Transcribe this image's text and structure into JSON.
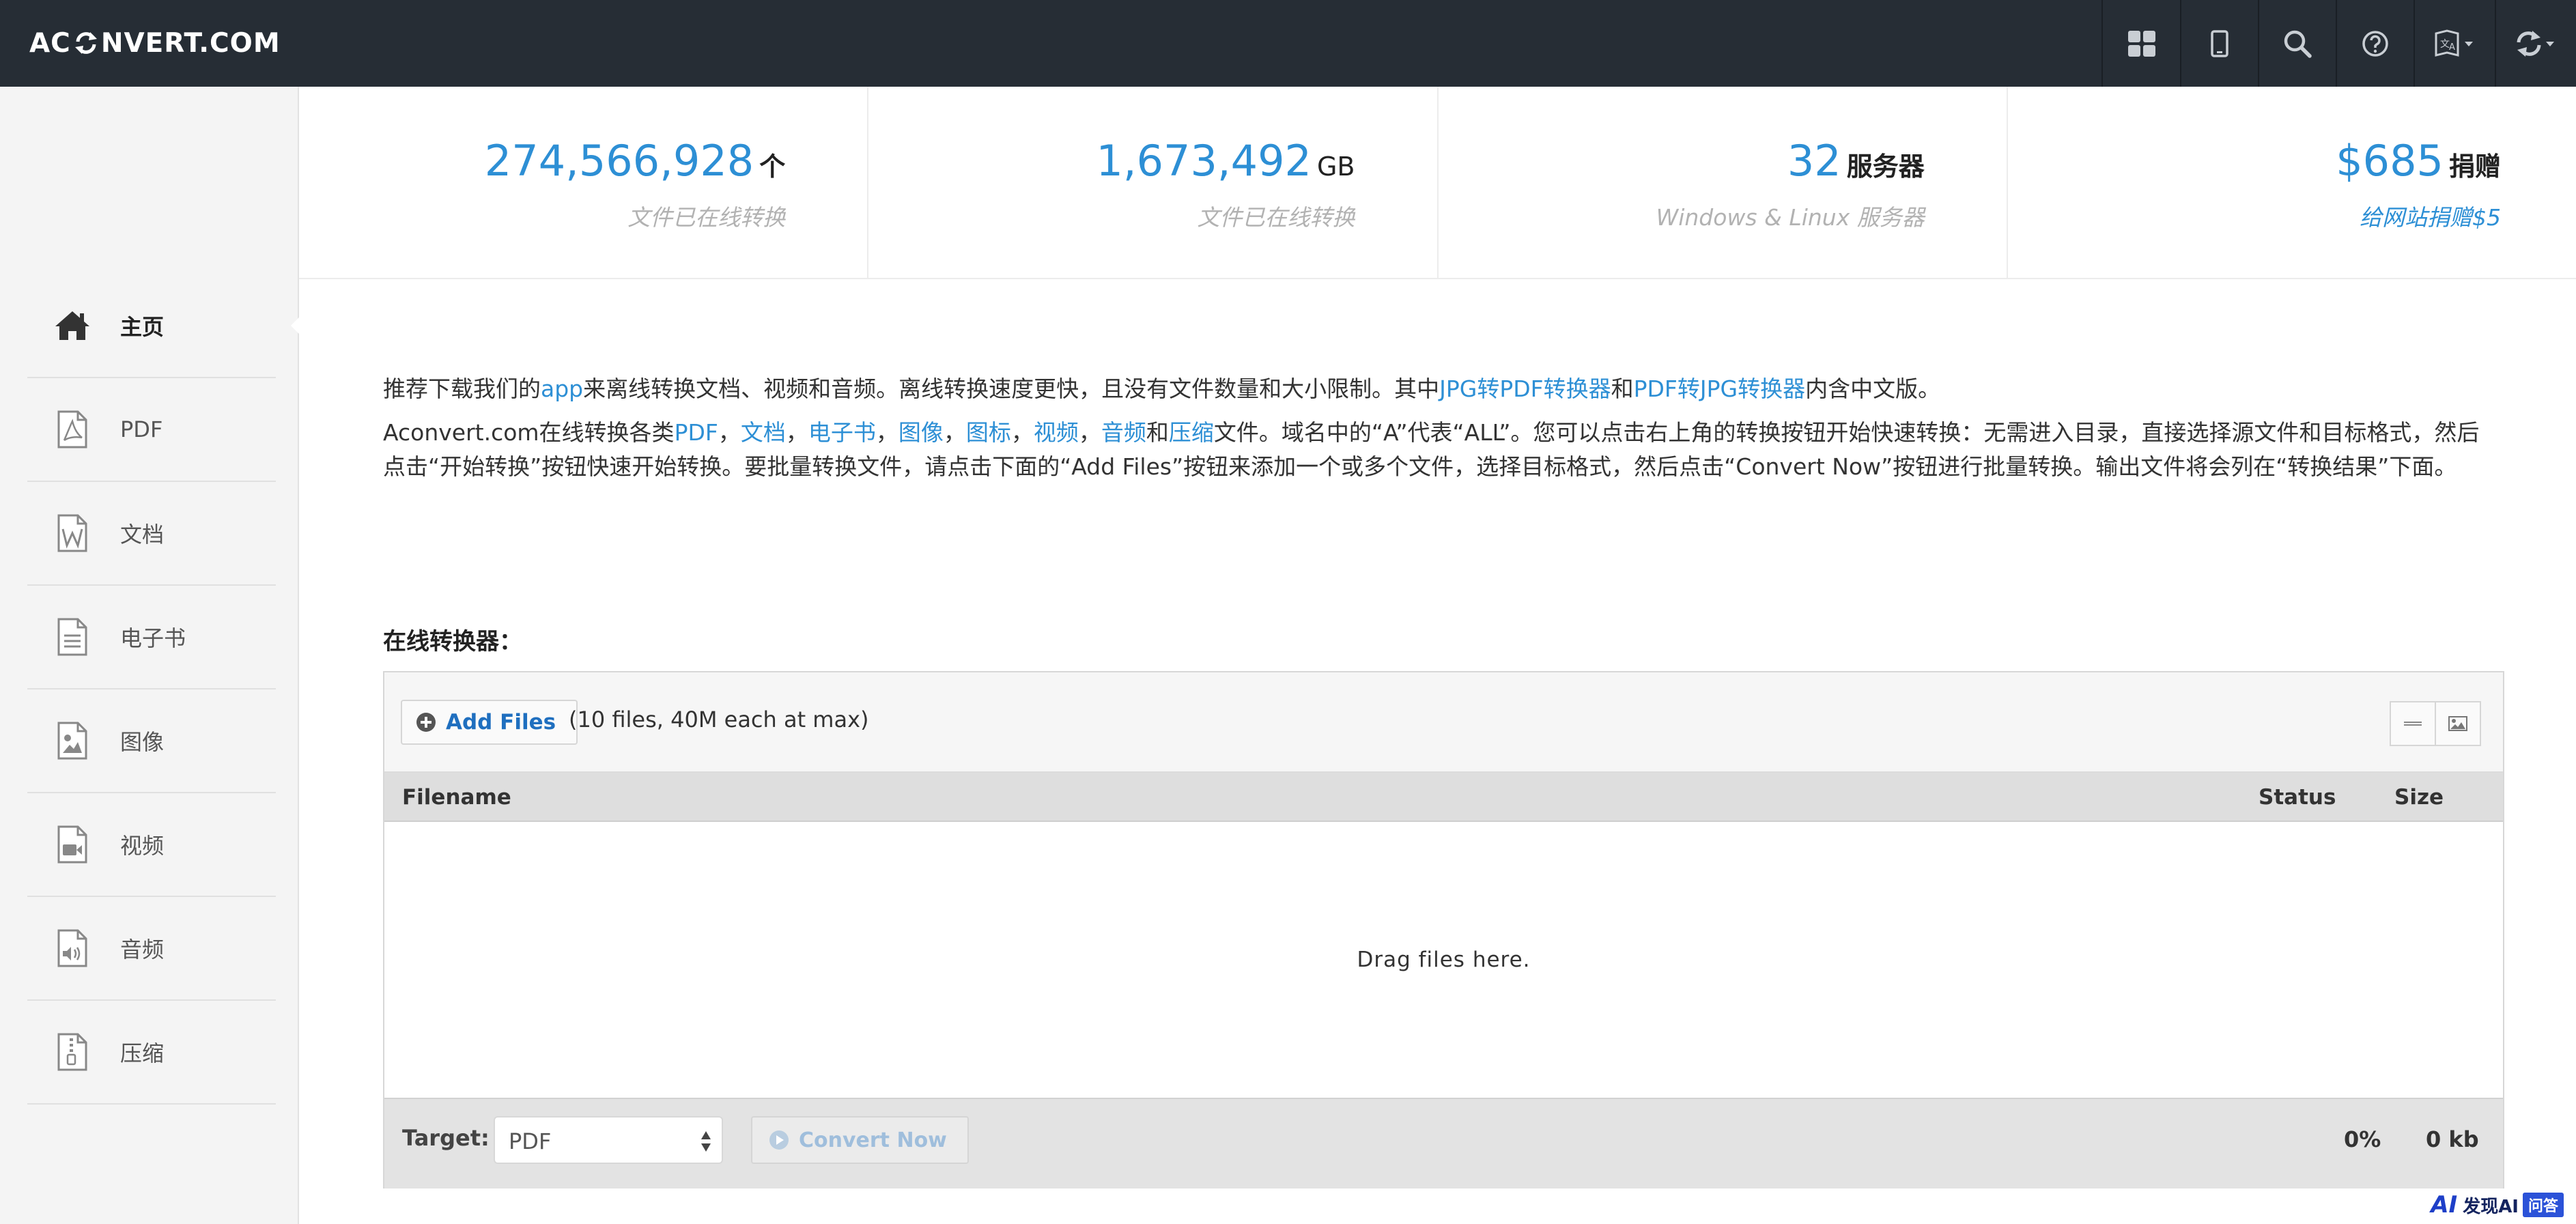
{
  "header": {
    "logo_left": "AC",
    "logo_right": "NVERT.COM",
    "buttons": [
      {
        "icon": "grid-icon"
      },
      {
        "icon": "mobile-icon"
      },
      {
        "icon": "search-icon"
      },
      {
        "icon": "help-icon"
      },
      {
        "icon": "language-icon"
      },
      {
        "icon": "refresh-icon"
      }
    ]
  },
  "sidebar": {
    "items": [
      {
        "label": "主页",
        "icon": "home-icon",
        "active": true
      },
      {
        "label": "PDF",
        "icon": "pdf-file-icon"
      },
      {
        "label": "文档",
        "icon": "word-file-icon"
      },
      {
        "label": "电子书",
        "icon": "ebook-file-icon"
      },
      {
        "label": "图像",
        "icon": "image-file-icon"
      },
      {
        "label": "视频",
        "icon": "video-file-icon"
      },
      {
        "label": "音频",
        "icon": "audio-file-icon"
      },
      {
        "label": "压缩",
        "icon": "archive-file-icon"
      }
    ]
  },
  "stats": [
    {
      "number": "274,566,928",
      "unit": "个",
      "sub": "文件已在线转换"
    },
    {
      "number": "1,673,492",
      "unit": "GB",
      "sub": "文件已在线转换"
    },
    {
      "number": "32",
      "unit": "服务器",
      "sub": "Windows & Linux 服务器"
    },
    {
      "number": "$685",
      "unit": "捐赠",
      "sub": "给网站捐赠$5"
    }
  ],
  "intro": {
    "p1": {
      "t1": "推荐下载我们的",
      "app": "app",
      "t2": "来离线转换文档、视频和音频。离线转换速度更快，且没有文件数量和大小限制。其中",
      "link1": "JPG转PDF转换器",
      "t3": "和",
      "link2": "PDF转JPG转换器",
      "t4": "内含中文版。"
    },
    "p2": {
      "t1": "Aconvert.com在线转换各类",
      "l_pdf": "PDF",
      "sep1": "，",
      "l_doc": "文档",
      "sep2": "，",
      "l_ebook": "电子书",
      "sep3": "，",
      "l_image": "图像",
      "sep4": "，",
      "l_icon": "图标",
      "sep5": "，",
      "l_video": "视频",
      "sep6": "，",
      "l_audio": "音频",
      "and": "和",
      "l_archive": "压缩",
      "t2": "文件。域名中的“A”代表“ALL”。您可以点击右上角的转换按钮开始快速转换：无需进入目录，直接选择源文件和目标格式，然后点击“开始转换”按钮快速开始转换。要批量转换文件，请点击下面的“Add Files”按钮来添加一个或多个文件，选择目标格式，然后点击“Convert Now”按钮进行批量转换。输出文件将会列在“转换结果”下面。"
    }
  },
  "converter": {
    "title": "在线转换器：",
    "add_files": "Add Files",
    "limit": "(10 files, 40M each at max)",
    "columns": {
      "filename": "Filename",
      "status": "Status",
      "size": "Size"
    },
    "drop_text": "Drag files here.",
    "target_label": "Target:",
    "target_value": "PDF",
    "convert_now": "Convert Now",
    "progress": "0%",
    "total_size": "0 kb"
  },
  "watermark": {
    "a": "AI",
    "b": "发现AI",
    "c": "问答"
  }
}
